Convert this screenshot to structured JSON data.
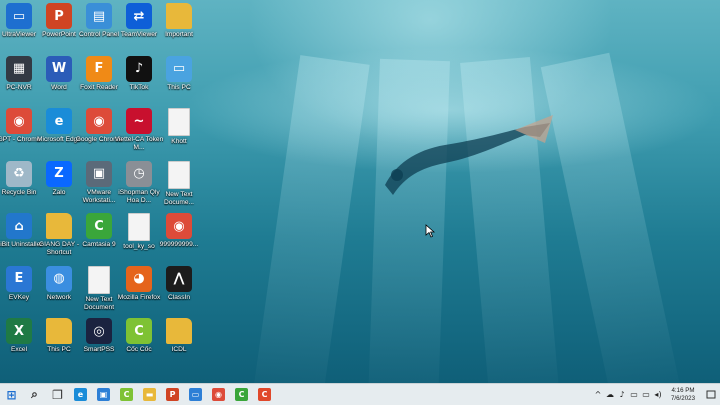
{
  "desktop_icons": [
    {
      "label": "UltraViewer",
      "icon": "ultraviewer-icon",
      "color": "#1e6fd0",
      "glyph": "▭"
    },
    {
      "label": "PowerPoint",
      "icon": "powerpoint-icon",
      "color": "#d04423",
      "glyph": "P"
    },
    {
      "label": "Control Panel",
      "icon": "control-panel-icon",
      "color": "#3a8fd8",
      "glyph": "▤"
    },
    {
      "label": "TeamViewer",
      "icon": "teamviewer-icon",
      "color": "#0e5fd8",
      "glyph": "⇄"
    },
    {
      "label": "Important",
      "icon": "folder-icon",
      "color": "#e8b83a",
      "glyph": ""
    },
    {
      "label": "PC-NVR",
      "icon": "pc-nvr-icon",
      "color": "#333a44",
      "glyph": "▦"
    },
    {
      "label": "Word",
      "icon": "word-icon",
      "color": "#2b5cb8",
      "glyph": "W"
    },
    {
      "label": "Foxit Reader",
      "icon": "foxit-reader-icon",
      "color": "#f08a16",
      "glyph": "F"
    },
    {
      "label": "TikTok",
      "icon": "tiktok-icon",
      "color": "#111111",
      "glyph": "♪"
    },
    {
      "label": "This PC",
      "icon": "this-pc-icon",
      "color": "#4aa3e0",
      "glyph": "▭"
    },
    {
      "label": "GPT - Chrome",
      "icon": "chrome-icon",
      "color": "#dd4b39",
      "glyph": "◉"
    },
    {
      "label": "Microsoft Edge",
      "icon": "edge-icon",
      "color": "#1a8cd8",
      "glyph": "e"
    },
    {
      "label": "Google Chrome",
      "icon": "chrome-icon",
      "color": "#dd4b39",
      "glyph": "◉"
    },
    {
      "label": "Viettel-CA Token M...",
      "icon": "viettel-ca-icon",
      "color": "#c8102e",
      "glyph": "~"
    },
    {
      "label": "Khott",
      "icon": "document-icon",
      "color": "#f4f4f4",
      "glyph": ""
    },
    {
      "label": "Recycle Bin",
      "icon": "recycle-bin-icon",
      "color": "#9fb8c8",
      "glyph": "♻"
    },
    {
      "label": "Zalo",
      "icon": "zalo-icon",
      "color": "#0a68ff",
      "glyph": "Z"
    },
    {
      "label": "VMware Workstati...",
      "icon": "vmware-icon",
      "color": "#5b6a79",
      "glyph": "▣"
    },
    {
      "label": "iShopman Qly Hoa D...",
      "icon": "ishopman-icon",
      "color": "#8a8f96",
      "glyph": "◷"
    },
    {
      "label": "New Text Docume...",
      "icon": "text-document-icon",
      "color": "#f4f4f4",
      "glyph": ""
    },
    {
      "label": "HiBit Uninstaller",
      "icon": "hibit-uninstaller-icon",
      "color": "#2277cc",
      "glyph": "⌂"
    },
    {
      "label": "GIANG DAY - Shortcut",
      "icon": "folder-shortcut-icon",
      "color": "#e8b83a",
      "glyph": ""
    },
    {
      "label": "Camtasia 9",
      "icon": "camtasia-icon",
      "color": "#3aa63a",
      "glyph": "C"
    },
    {
      "label": "tool_ky_so",
      "icon": "file-icon",
      "color": "#f4f4f4",
      "glyph": ""
    },
    {
      "label": "999999999...",
      "icon": "chrome-profile-icon",
      "color": "#dd4b39",
      "glyph": "◉"
    },
    {
      "label": "EVKey",
      "icon": "evkey-icon",
      "color": "#2a77d4",
      "glyph": "E"
    },
    {
      "label": "Network",
      "icon": "network-icon",
      "color": "#3b8ee0",
      "glyph": "◍"
    },
    {
      "label": "New Text Document",
      "icon": "text-document-icon",
      "color": "#f4f4f4",
      "glyph": ""
    },
    {
      "label": "Mozilla Firefox",
      "icon": "firefox-icon",
      "color": "#e5641c",
      "glyph": "◕"
    },
    {
      "label": "ClassIn",
      "icon": "classin-icon",
      "color": "#1c1c1c",
      "glyph": "⋀"
    },
    {
      "label": "Excel",
      "icon": "excel-icon",
      "color": "#1f7a45",
      "glyph": "X"
    },
    {
      "label": "This PC",
      "icon": "user-folder-icon",
      "color": "#e8b83a",
      "glyph": ""
    },
    {
      "label": "SmartPSS",
      "icon": "smartpss-icon",
      "color": "#1b2340",
      "glyph": "◎"
    },
    {
      "label": "Cốc Cốc",
      "icon": "coccoc-icon",
      "color": "#7ec234",
      "glyph": "C"
    },
    {
      "label": "ICDL",
      "icon": "icdl-icon",
      "color": "#e8b83a",
      "glyph": ""
    }
  ],
  "taskbar": {
    "apps": [
      {
        "icon": "windows-start-icon",
        "color": "#1e6fd0",
        "glyph": "⊞"
      },
      {
        "icon": "search-icon",
        "color": "#333333",
        "glyph": "⌕"
      },
      {
        "icon": "task-view-icon",
        "color": "#333333",
        "glyph": "❐"
      },
      {
        "icon": "edge-icon",
        "color": "#1a8cd8",
        "glyph": "e"
      },
      {
        "icon": "store-icon",
        "color": "#2d7fd6",
        "glyph": "▣"
      },
      {
        "icon": "coccoc-icon",
        "color": "#7ec234",
        "glyph": "C"
      },
      {
        "icon": "file-explorer-icon",
        "color": "#e8b83a",
        "glyph": "▬"
      },
      {
        "icon": "powerpoint-icon",
        "color": "#d04423",
        "glyph": "P"
      },
      {
        "icon": "remote-desktop-icon",
        "color": "#2d7fd6",
        "glyph": "▭"
      },
      {
        "icon": "chrome-icon",
        "color": "#dd4b39",
        "glyph": "◉"
      },
      {
        "icon": "camtasia-icon",
        "color": "#3aa63a",
        "glyph": "C"
      },
      {
        "icon": "camtasia-recorder-icon",
        "color": "#e0482a",
        "glyph": "C"
      }
    ],
    "tray_icons": [
      "chevron-up-icon",
      "onedrive-icon",
      "microphone-icon",
      "battery-icon",
      "network-icon",
      "volume-icon"
    ],
    "tray_glyphs": [
      "^",
      "☁",
      "♪",
      "▭",
      "▭",
      "◂)"
    ],
    "time": "4:16 PM",
    "date": "7/6/2023"
  }
}
